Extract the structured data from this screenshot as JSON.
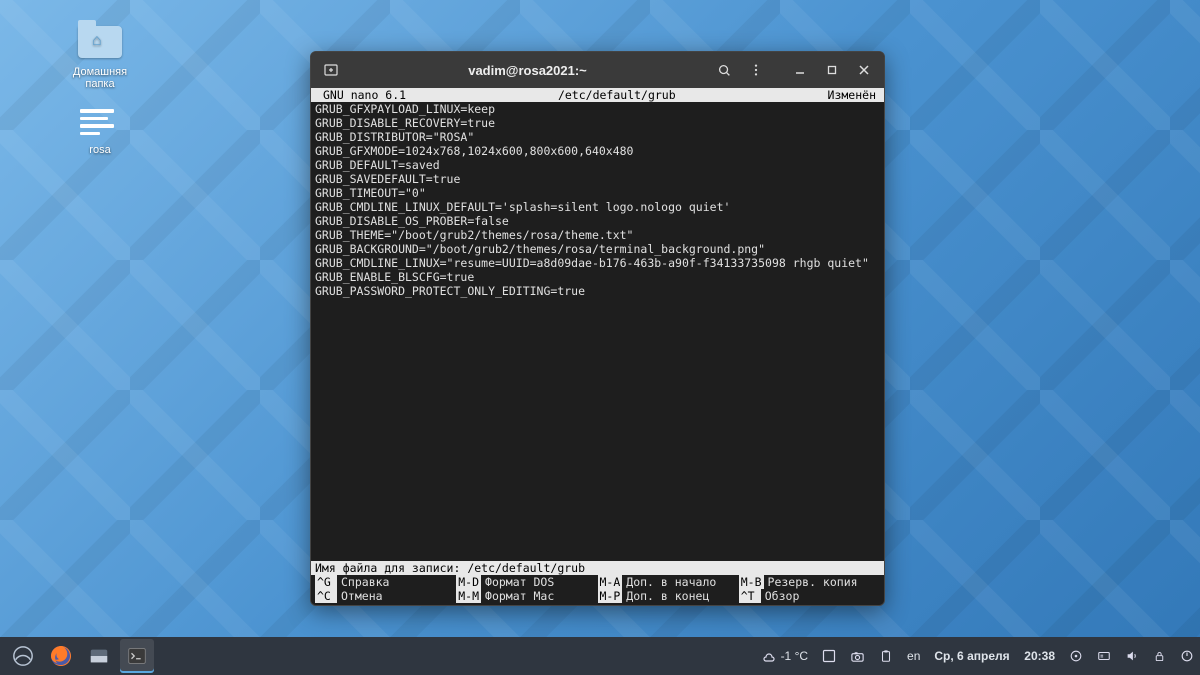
{
  "desktop": {
    "icons": [
      {
        "name": "home-folder",
        "label": "Домашняя\nпапка"
      },
      {
        "name": "rosa-document",
        "label": "rosa"
      }
    ]
  },
  "terminal": {
    "title": "vadim@rosa2021:~",
    "nano": {
      "app": "GNU nano 6.1",
      "file": "/etc/default/grub",
      "status": "Изменён",
      "content": "GRUB_GFXPAYLOAD_LINUX=keep\nGRUB_DISABLE_RECOVERY=true\nGRUB_DISTRIBUTOR=\"ROSA\"\nGRUB_GFXMODE=1024x768,1024x600,800x600,640x480\nGRUB_DEFAULT=saved\nGRUB_SAVEDEFAULT=true\nGRUB_TIMEOUT=\"0\"\nGRUB_CMDLINE_LINUX_DEFAULT='splash=silent logo.nologo quiet'\nGRUB_DISABLE_OS_PROBER=false\nGRUB_THEME=\"/boot/grub2/themes/rosa/theme.txt\"\nGRUB_BACKGROUND=\"/boot/grub2/themes/rosa/terminal_background.png\"\nGRUB_CMDLINE_LINUX=\"resume=UUID=a8d09dae-b176-463b-a90f-f34133735098 rhgb quiet\"\nGRUB_ENABLE_BLSCFG=true\nGRUB_PASSWORD_PROTECT_ONLY_EDITING=true",
      "prompt": "Имя файла для записи: /etc/default/grub",
      "help": [
        {
          "key": "^G",
          "label": "Справка"
        },
        {
          "key": "M-D",
          "label": "Формат DOS"
        },
        {
          "key": "M-A",
          "label": "Доп. в начало"
        },
        {
          "key": "M-B",
          "label": "Резерв. копия"
        },
        {
          "key": "^C",
          "label": "Отмена"
        },
        {
          "key": "M-M",
          "label": "Формат Mac"
        },
        {
          "key": "M-P",
          "label": "Доп. в конец"
        },
        {
          "key": "^T",
          "label": "Обзор"
        }
      ]
    }
  },
  "taskbar": {
    "weather": "-1 °C",
    "lang": "en",
    "date": "Ср, 6 апреля",
    "time": "20:38"
  }
}
